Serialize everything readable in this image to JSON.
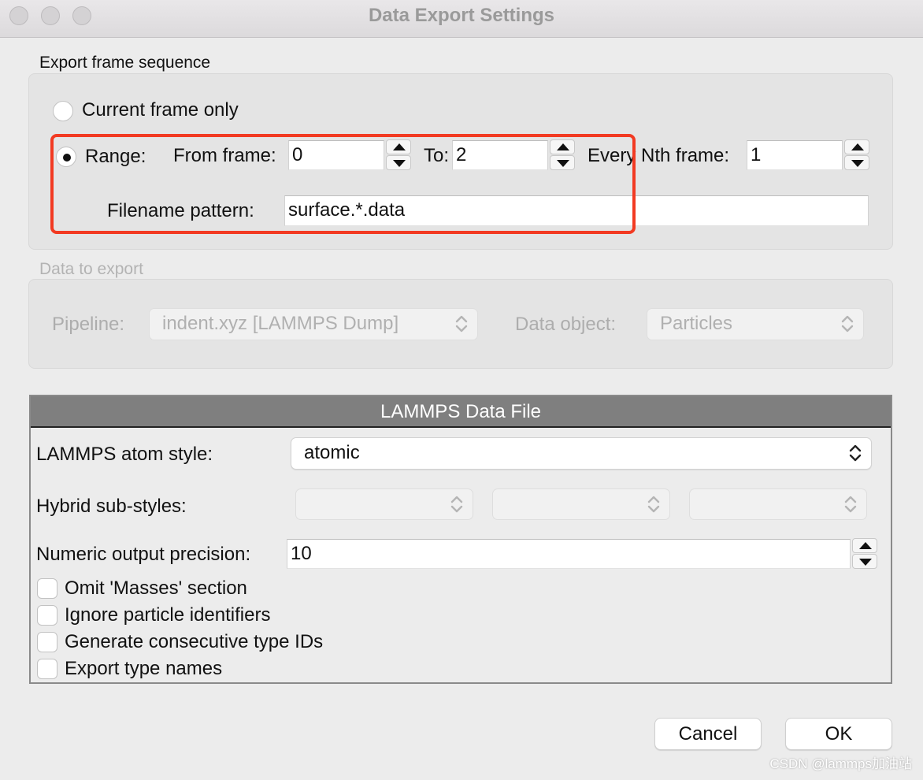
{
  "window": {
    "title": "Data Export Settings"
  },
  "export_frame_sequence": {
    "group_label": "Export frame sequence",
    "current_frame_label": "Current frame only",
    "range_label": "Range:",
    "from_label": "From frame:",
    "from_value": "0",
    "to_label": "To:",
    "to_value": "2",
    "every_label": "Every Nth frame:",
    "every_value": "1",
    "filename_label": "Filename pattern:",
    "filename_value": "surface.*.data",
    "selected": "range"
  },
  "data_to_export": {
    "group_label": "Data to export",
    "pipeline_label": "Pipeline:",
    "pipeline_value": "indent.xyz [LAMMPS Dump]",
    "data_object_label": "Data object:",
    "data_object_value": "Particles"
  },
  "lammps": {
    "header": "LAMMPS Data File",
    "atom_style_label": "LAMMPS atom style:",
    "atom_style_value": "atomic",
    "hybrid_label": "Hybrid sub-styles:",
    "precision_label": "Numeric output precision:",
    "precision_value": "10",
    "options": [
      {
        "label": "Omit 'Masses' section",
        "checked": false
      },
      {
        "label": "Ignore particle identifiers",
        "checked": false
      },
      {
        "label": "Generate consecutive type IDs",
        "checked": false
      },
      {
        "label": "Export type names",
        "checked": false
      }
    ]
  },
  "buttons": {
    "cancel": "Cancel",
    "ok": "OK"
  },
  "watermark": "CSDN @lammps加油站",
  "colors": {
    "highlight": "#f23a22",
    "header_bg": "#7f7f7f"
  }
}
